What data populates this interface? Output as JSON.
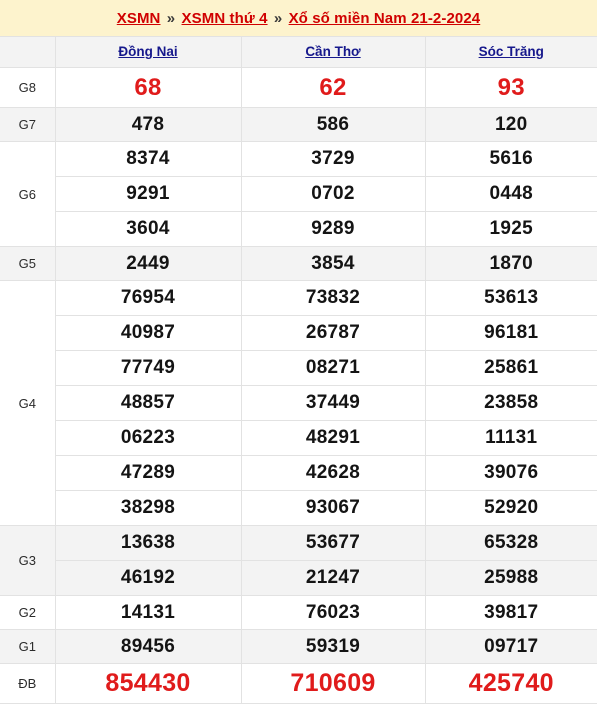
{
  "header": {
    "breadcrumb": [
      {
        "type": "link",
        "text": "XSMN"
      },
      {
        "type": "sep",
        "text": "»"
      },
      {
        "type": "link",
        "text": "XSMN thứ 4"
      },
      {
        "type": "sep",
        "text": "»"
      },
      {
        "type": "link",
        "text": "Xổ số miền Nam 21-2-2024"
      }
    ],
    "breadcrumb_plain": "XSMN » XSMN thứ 4 » Xổ số miền Nam 21-2-2024"
  },
  "colors": {
    "band_background": "#fdf3cd",
    "link_red": "#d00000",
    "province_link_blue": "#16188c",
    "highlight_red": "#e01b1b",
    "number_black": "#141414",
    "row_shade": "#f3f3f3",
    "grid_line": "#e2e2e2"
  },
  "table": {
    "corner_label": "",
    "columns": [
      {
        "label": "Đồng Nai"
      },
      {
        "label": "Cần Thơ"
      },
      {
        "label": "Sóc Trăng"
      }
    ],
    "prizes": [
      {
        "label": "G8",
        "style": "highlight",
        "shade": false,
        "rows": [
          [
            "68",
            "62",
            "93"
          ]
        ]
      },
      {
        "label": "G7",
        "style": "normal",
        "shade": true,
        "rows": [
          [
            "478",
            "586",
            "120"
          ]
        ]
      },
      {
        "label": "G6",
        "style": "normal",
        "shade": false,
        "rows": [
          [
            "8374",
            "3729",
            "5616"
          ],
          [
            "9291",
            "0702",
            "0448"
          ],
          [
            "3604",
            "9289",
            "1925"
          ]
        ]
      },
      {
        "label": "G5",
        "style": "normal",
        "shade": true,
        "rows": [
          [
            "2449",
            "3854",
            "1870"
          ]
        ]
      },
      {
        "label": "G4",
        "style": "normal",
        "shade": false,
        "rows": [
          [
            "76954",
            "73832",
            "53613"
          ],
          [
            "40987",
            "26787",
            "96181"
          ],
          [
            "77749",
            "08271",
            "25861"
          ],
          [
            "48857",
            "37449",
            "23858"
          ],
          [
            "06223",
            "48291",
            "11131"
          ],
          [
            "47289",
            "42628",
            "39076"
          ],
          [
            "38298",
            "93067",
            "52920"
          ]
        ]
      },
      {
        "label": "G3",
        "style": "normal",
        "shade": true,
        "rows": [
          [
            "13638",
            "53677",
            "65328"
          ],
          [
            "46192",
            "21247",
            "25988"
          ]
        ]
      },
      {
        "label": "G2",
        "style": "normal",
        "shade": false,
        "rows": [
          [
            "14131",
            "76023",
            "39817"
          ]
        ]
      },
      {
        "label": "G1",
        "style": "normal",
        "shade": true,
        "rows": [
          [
            "89456",
            "59319",
            "09717"
          ]
        ]
      },
      {
        "label": "ĐB",
        "style": "jackpot",
        "shade": false,
        "rows": [
          [
            "854430",
            "710609",
            "425740"
          ]
        ]
      }
    ]
  }
}
